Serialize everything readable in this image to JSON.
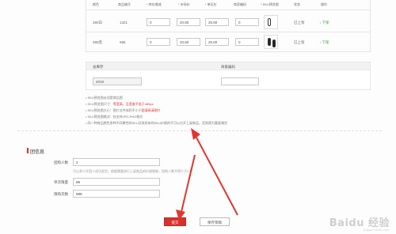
{
  "sku_table": {
    "headers": {
      "color": "颜色",
      "product_code": "商品编号",
      "stock": "* 库存增减",
      "market_price": "* 市场价",
      "unit_price": "* 单买价",
      "merchant_code": "商家编码",
      "sku_image": "* SKU预览图",
      "status": "状态",
      "action": "操作"
    },
    "rows": [
      {
        "color": "390白",
        "product_code": "1321",
        "stock": "0",
        "market_price": "20.80",
        "unit_price": "25.80",
        "merchant_code": "0",
        "status": "已上架",
        "action": "下架"
      },
      {
        "color": "390黑",
        "product_code": "698",
        "stock": "0",
        "market_price": "20.80",
        "unit_price": "25.80",
        "merchant_code": "0",
        "status": "已上架",
        "action": "下架"
      }
    ]
  },
  "summary": {
    "total_stock_label": "总库存",
    "total_stock_value": "2019",
    "merchant_code_label": "商家编码"
  },
  "notes": [
    {
      "text": "SKU预览图必须是商品图",
      "red": ""
    },
    {
      "text": "SKU预览图尺寸：",
      "red": "等宽高，且宽度不低于480px"
    },
    {
      "text": "SKU预览图大小：图片文件体积不小于",
      "red": "超清高清图片"
    },
    {
      "text": "SKU预览图格式：仅支持JPG,PNG格式",
      "red": ""
    },
    {
      "text": "同一种商品颜色多种不同属性的SKU及其所有的SKU价格的不可以分开上架商品，否则视为重复铺货",
      "red": ""
    }
  ],
  "group": {
    "title": "团信息",
    "fields": [
      {
        "label": "团购人数",
        "value": "2",
        "hint": "可以多少开团人成功发货，根据需要进行上架商品的价格限制，团购人数不得少于2人"
      },
      {
        "label": "单次限量",
        "value": "99",
        "hint": ""
      },
      {
        "label": "限购次数",
        "value": "999",
        "hint": ""
      }
    ]
  },
  "buttons": {
    "submit": "提交",
    "save_draft": "保存草稿"
  },
  "watermark": {
    "text": "Baidu 经验",
    "sub": "jingyan.baidu.com"
  },
  "colors": {
    "accent": "#d9302c",
    "action_link": "#3aa03a",
    "arrow": "#e0352f"
  }
}
